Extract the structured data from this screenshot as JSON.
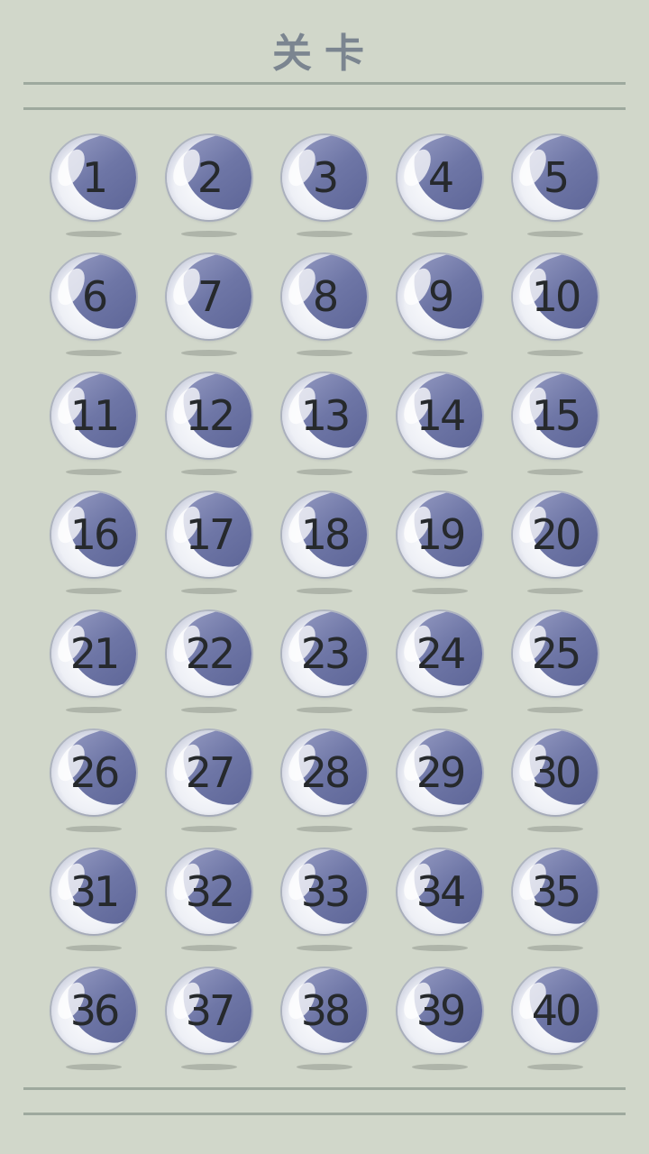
{
  "header": {
    "title": "关卡"
  },
  "levels": [
    "1",
    "2",
    "3",
    "4",
    "5",
    "6",
    "7",
    "8",
    "9",
    "10",
    "11",
    "12",
    "13",
    "14",
    "15",
    "16",
    "17",
    "18",
    "19",
    "20",
    "21",
    "22",
    "23",
    "24",
    "25",
    "26",
    "27",
    "28",
    "29",
    "30",
    "31",
    "32",
    "33",
    "34",
    "35",
    "36",
    "37",
    "38",
    "39",
    "40"
  ],
  "colors": {
    "background": "#d1d7ca",
    "title": "#7b8590",
    "rule": "#9ea99e",
    "ball_blue": "#6e76a6",
    "number": "#26292c"
  }
}
